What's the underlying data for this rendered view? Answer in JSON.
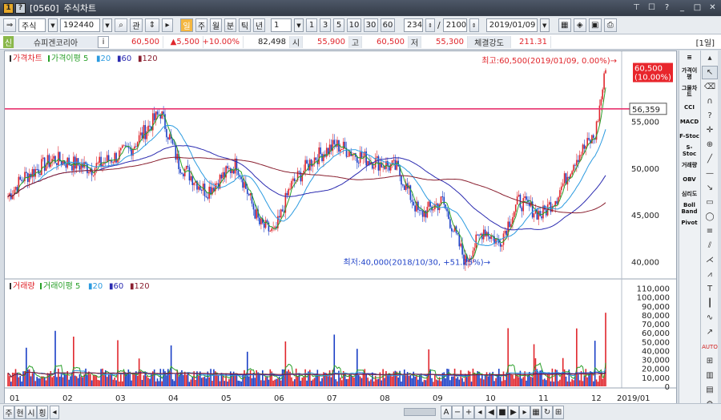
{
  "window": {
    "code": "[0560]",
    "title": "주식차트"
  },
  "toolbar": {
    "market": "주식",
    "code": "192440",
    "search_label": "관",
    "periods": [
      "주",
      "월",
      "분",
      "틱",
      "년"
    ],
    "interval": "1",
    "nums": [
      "1",
      "3",
      "5",
      "10",
      "30",
      "60"
    ],
    "count": "234",
    "total": "2100",
    "date": "2019/01/09"
  },
  "info": {
    "tag": "신",
    "name": "슈피겐코리아",
    "info_btn": "i",
    "price": "60,500",
    "change": "▲5,500",
    "pct": "+10.00%",
    "volume": "82,498",
    "open_lbl": "시",
    "open": "55,900",
    "high_lbl": "고",
    "high": "60,500",
    "low_lbl": "저",
    "low": "55,300",
    "strength_lbl": "체결강도",
    "strength": "211.31",
    "period_tag": "[1일]"
  },
  "price_panel": {
    "title": "가격차트",
    "ma_label": "가격이평",
    "ma": [
      "5",
      "20",
      "60",
      "120"
    ],
    "high_note": "최고:60,500(2019/01/09, 0.00%)→",
    "low_note": "최저:40,000(2018/10/30, +51.25%)→",
    "last_price": "60,500",
    "last_pct": "(10.00%)",
    "hline_value": "56,359",
    "y_ticks": [
      "55,000",
      "50,000",
      "45,000",
      "40,000"
    ]
  },
  "volume_panel": {
    "title": "거래량",
    "ma_label": "거래이평",
    "ma": [
      "5",
      "20",
      "60",
      "120"
    ],
    "y_ticks": [
      "110,000",
      "100,000",
      "90,000",
      "80,000",
      "70,000",
      "60,000",
      "50,000",
      "40,000",
      "30,000",
      "20,000",
      "10,000",
      "0"
    ]
  },
  "x_axis": [
    "01",
    "02",
    "03",
    "04",
    "05",
    "06",
    "07",
    "08",
    "09",
    "10",
    "11",
    "12",
    "2019/01"
  ],
  "indicators": [
    "가격이평",
    "그물차트",
    "CCI",
    "MACD",
    "F-Stoc",
    "S-Stoc",
    "거래량",
    "OBV",
    "심리도",
    "Boll Band",
    "Pivot"
  ],
  "bottom": {
    "tabs": [
      "주",
      "현",
      "시",
      "횡"
    ]
  },
  "colors": {
    "up": "#e0262c",
    "down": "#1a3fc6",
    "ma5": "#2aa02a",
    "ma20": "#2c9be0",
    "ma60": "#2b2bb0",
    "ma120": "#8a2030",
    "hline": "#e8336e"
  }
}
